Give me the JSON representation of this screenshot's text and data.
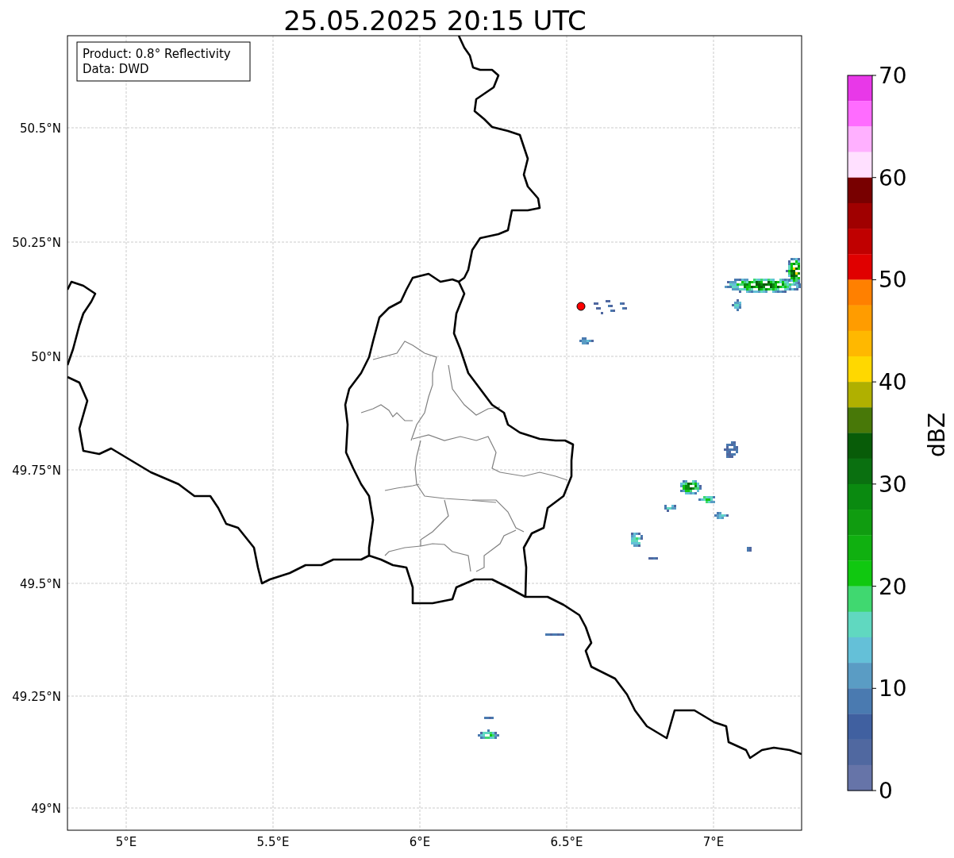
{
  "title": "25.05.2025 20:15 UTC",
  "info_box": {
    "lines": [
      "Product: 0.8° Reflectivity",
      "Data: DWD"
    ]
  },
  "map": {
    "lat_labels": [
      "50.5°N",
      "50.25°N",
      "50°N",
      "49.75°N",
      "49.5°N",
      "49.25°N",
      "49°N"
    ],
    "lon_labels": [
      "5°E",
      "5.5°E",
      "6°E",
      "6.5°E",
      "7°E"
    ]
  },
  "colorbar": {
    "label": "dBZ",
    "ticks": [
      "70",
      "60",
      "50",
      "40",
      "30",
      "20",
      "10",
      "0"
    ],
    "bands": [
      {
        "color": "#e838e8"
      },
      {
        "color": "#ff6cff"
      },
      {
        "color": "#ffb0ff"
      },
      {
        "color": "#ffe0ff"
      },
      {
        "color": "#780000"
      },
      {
        "color": "#a00000"
      },
      {
        "color": "#c00000"
      },
      {
        "color": "#e00000"
      },
      {
        "color": "#ff8000"
      },
      {
        "color": "#ff9c00"
      },
      {
        "color": "#ffb800"
      },
      {
        "color": "#ffd800"
      },
      {
        "color": "#b0b000"
      },
      {
        "color": "#487808"
      },
      {
        "color": "#085c08"
      },
      {
        "color": "#0a7010"
      },
      {
        "color": "#0a8a10"
      },
      {
        "color": "#109c10"
      },
      {
        "color": "#10b010"
      },
      {
        "color": "#10c810"
      },
      {
        "color": "#40d870"
      },
      {
        "color": "#60d8c0"
      },
      {
        "color": "#64c0d8"
      },
      {
        "color": "#5a9cc4"
      },
      {
        "color": "#4a7ab0"
      },
      {
        "color": "#4060a0"
      },
      {
        "color": "#5068a0"
      },
      {
        "color": "#6674a8"
      }
    ]
  }
}
